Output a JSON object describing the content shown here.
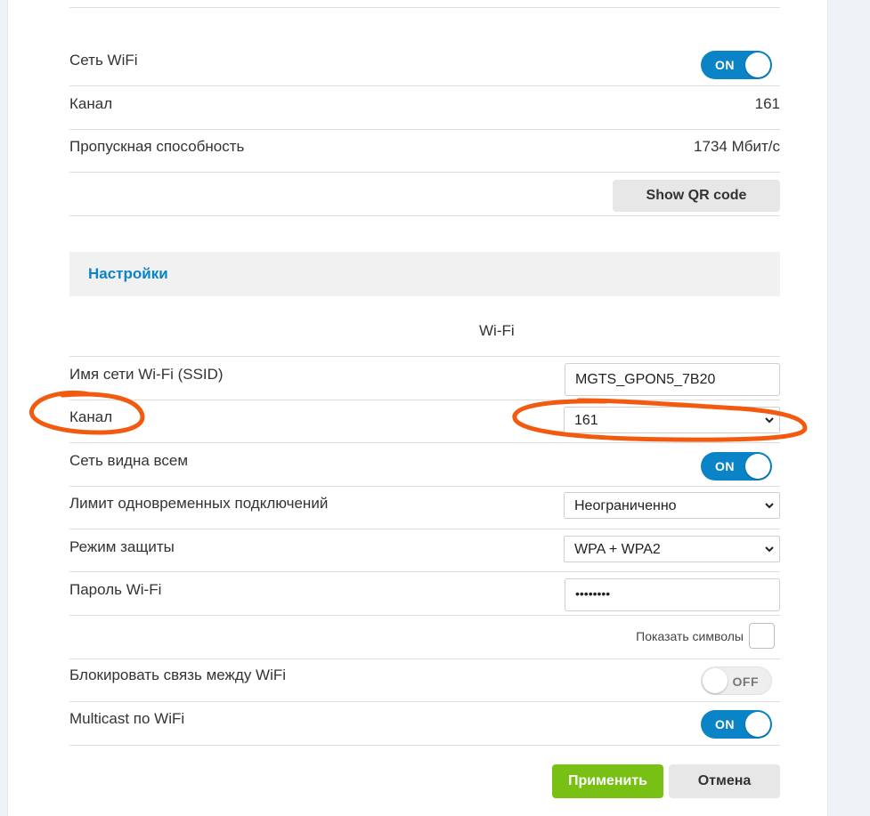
{
  "status": {
    "wifi_label": "Сеть WiFi",
    "wifi_toggle": "ON",
    "channel_label": "Канал",
    "channel_value": "161",
    "bandwidth_label": "Пропускная способность",
    "bandwidth_value": "1734 Мбит/с",
    "qr_button": "Show QR code"
  },
  "settings": {
    "header": "Настройки",
    "column_header": "Wi-Fi",
    "ssid_label": "Имя сети Wi-Fi (SSID)",
    "ssid_value": "MGTS_GPON5_7B20",
    "channel_label": "Канал",
    "channel_value": "161",
    "visible_label": "Сеть видна всем",
    "visible_toggle": "ON",
    "limit_label": "Лимит одновременных подключений",
    "limit_value": "Неограниченно",
    "security_label": "Режим защиты",
    "security_value": "WPA + WPA2",
    "password_label": "Пароль Wi-Fi",
    "password_value": "••••••••",
    "show_chars_label": "Показать символы",
    "block_label": "Блокировать связь между WiFi",
    "block_toggle": "OFF",
    "multicast_label": "Multicast по WiFi",
    "multicast_toggle": "ON"
  },
  "actions": {
    "apply": "Применить",
    "cancel": "Отмена"
  },
  "colors": {
    "accent_blue": "#0a84c6",
    "apply_green": "#78c014",
    "annotation_orange": "#f25a0f"
  },
  "icons": {
    "select_arrow": "chevron-down-icon"
  }
}
